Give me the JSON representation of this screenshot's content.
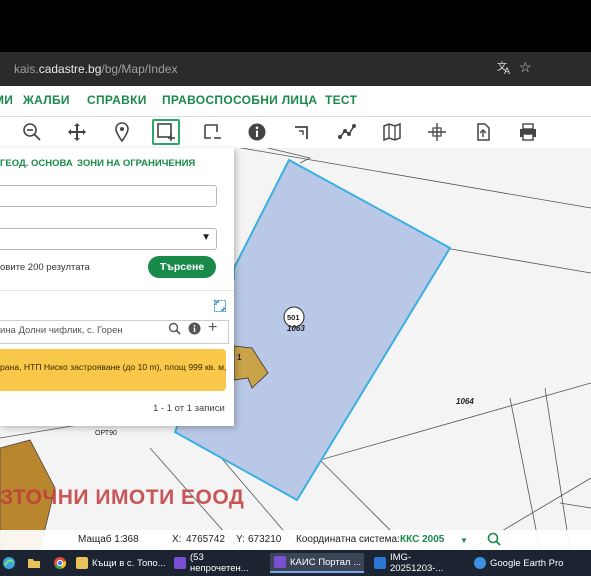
{
  "browser": {
    "url_host": "kais.",
    "url_domain": "cadastre.bg",
    "url_path": "/bg/Map/Index"
  },
  "menu": {
    "items": [
      "МИ",
      "ЖАЛБИ",
      "СПРАВКИ",
      "ПРАВОСПОСОБНИ ЛИЦА",
      "ТЕСТ"
    ]
  },
  "toolbar": {
    "icons": [
      "zoom-out-icon",
      "pan-icon",
      "location-pin-icon",
      "select-rectangle-icon",
      "select-area-icon",
      "info-icon",
      "measure-icon",
      "route-icon",
      "map-layers-icon",
      "coordinates-icon",
      "export-icon",
      "print-icon"
    ]
  },
  "panel": {
    "tab_geo": "ГЕОД. ОСНОВА",
    "tab_zones": "ЗОНИ НА ОГРАНИЧЕНИЯ",
    "result_hint": "овите 200 резултата",
    "search_button": "Търсене",
    "result_row_text": "ина Долни чифлик, с. Горен",
    "result_item": "рана, НТП Ниско застрояване (до 10 m), площ 999 кв. м,",
    "records": "1 - 1 от 1 записи"
  },
  "map": {
    "parcel_number": "501",
    "parcel_id": "1063",
    "neighbor_id": "1064",
    "point_label": "ОРТ90",
    "building_label": "1",
    "watermark": "ЗТОЧНИ ИМОТИ ЕООД"
  },
  "status": {
    "scale_label": "Мащаб 1:",
    "scale_value": "368",
    "x_label": "X:",
    "x_value": "4765742",
    "y_label": "Y:",
    "y_value": "673210",
    "crs_label": "Координатна система:",
    "crs_value": "ККС 2005"
  },
  "taskbar": {
    "items": [
      {
        "label": "Къщи в с. Топо...",
        "color": "#e8c15a"
      },
      {
        "label": "(53 непрочетен...",
        "color": "#7b4fd1"
      },
      {
        "label": "КАИС Портал ...",
        "color": "#7b4fd1"
      },
      {
        "label": "IMG-20251203-...",
        "color": "#2b77d6"
      },
      {
        "label": "Google Earth Pro",
        "color": "#3d8fe0"
      }
    ]
  },
  "colors": {
    "accent_green": "#1a8a4a",
    "parcel_fill": "#b9c8e6",
    "parcel_stroke": "#3ab0e0",
    "result_highlight": "#f9c84a"
  }
}
